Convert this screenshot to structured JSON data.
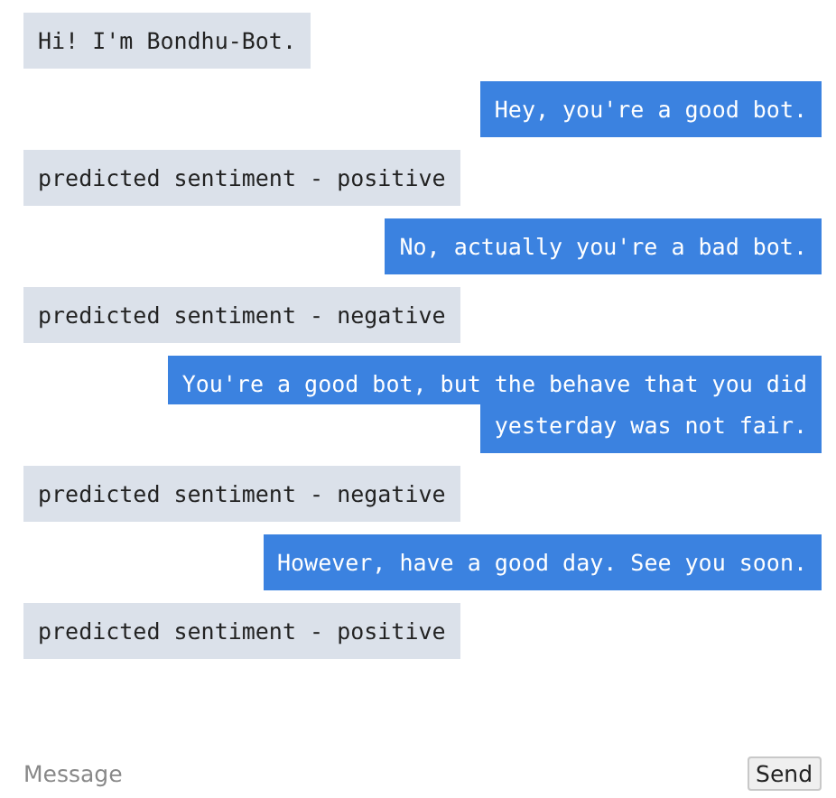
{
  "messages": [
    {
      "kind": "bot",
      "lines": [
        "Hi! I'm Bondhu-Bot."
      ]
    },
    {
      "kind": "user",
      "lines": [
        "Hey, you're a good bot."
      ]
    },
    {
      "kind": "bot",
      "lines": [
        "predicted sentiment - positive"
      ]
    },
    {
      "kind": "user",
      "lines": [
        "No, actually you're a bad bot."
      ]
    },
    {
      "kind": "bot",
      "lines": [
        "predicted sentiment - negative"
      ]
    },
    {
      "kind": "user",
      "lines": [
        "You're a good bot, but the behave that you did",
        "yesterday was not fair."
      ]
    },
    {
      "kind": "bot",
      "lines": [
        "predicted sentiment - negative"
      ]
    },
    {
      "kind": "user",
      "lines": [
        "However, have a good day. See you soon."
      ]
    },
    {
      "kind": "bot",
      "lines": [
        "predicted sentiment - positive"
      ]
    }
  ],
  "composer": {
    "placeholder": "Message",
    "send_button": "Send"
  }
}
